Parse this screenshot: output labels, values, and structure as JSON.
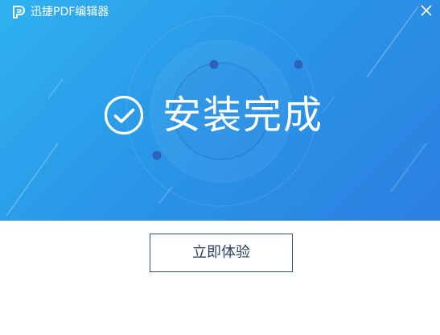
{
  "window": {
    "title": "迅捷PDF编辑器",
    "logo_icon": "pdf-logo-icon",
    "close_icon": "close-icon"
  },
  "banner": {
    "status_icon": "check-circle-icon",
    "status_text": "安装完成",
    "gradient_colors": [
      "#2fb2f0",
      "#2a97e8",
      "#2b7fe0"
    ]
  },
  "actions": {
    "primary_label": "立即体验",
    "border_color": "#2b4f7a"
  }
}
